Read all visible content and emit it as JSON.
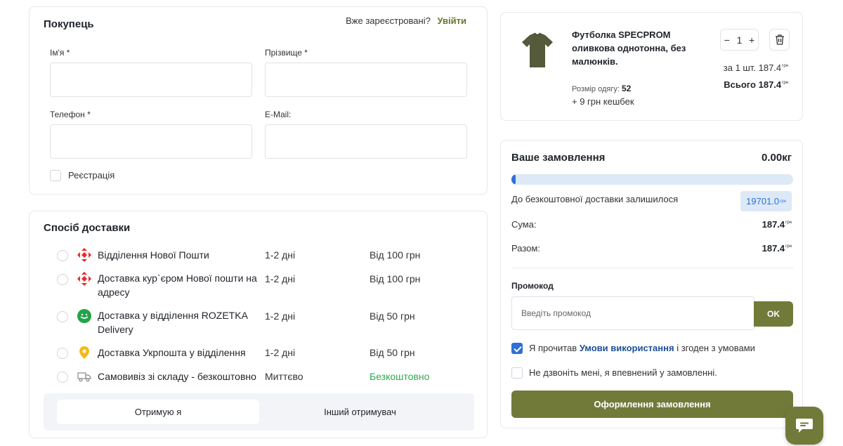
{
  "buyer": {
    "title": "Покупець",
    "registered_text": "Вже зареєстровані?",
    "login_link": "Увійти",
    "first_name_label": "Ім'я *",
    "last_name_label": "Прізвище *",
    "phone_label": "Телефон *",
    "email_label": "E-Mail:",
    "register_label": "Реєстрація"
  },
  "delivery": {
    "title": "Спосіб доставки",
    "options": [
      {
        "name": "Відділення Нової Пошти",
        "time": "1-2 дні",
        "price": "Від 100 грн",
        "icon": "nova-poshta-icon"
      },
      {
        "name": "Доставка кур`єром Нової пошти на адресу",
        "time": "1-2 дні",
        "price": "Від 100 грн",
        "icon": "nova-poshta-icon"
      },
      {
        "name": "Доставка у відділення ROZETKA Delivery",
        "time": "1-2 дні",
        "price": "Від 50 грн",
        "icon": "rozetka-icon"
      },
      {
        "name": "Доставка Укрпошта у відділення",
        "time": "1-2 дні",
        "price": "Від 50 грн",
        "icon": "ukrposhta-icon"
      },
      {
        "name": "Самовивіз зі складу - безкоштовно",
        "time": "Миттєво",
        "price": "Безкоштовно",
        "icon": "truck-icon"
      }
    ],
    "recipient_self": "Отримую я",
    "recipient_other": "Інший отримувач"
  },
  "product": {
    "name": "Футболка SPECPROM оливкова однотонна, без малюнків.",
    "size_label": "Розмір одягу:",
    "size_value": "52",
    "cashback": "+ 9 грн кешбек",
    "quantity": "1",
    "minus": "−",
    "plus": "+",
    "per_unit_label": "за 1 шт.",
    "per_unit_price": "187.4",
    "total_label": "Всього",
    "total_price": "187.4",
    "currency": "грн"
  },
  "order": {
    "title": "Ваше замовлення",
    "weight": "0.00кг",
    "free_delivery_progress": 0.01,
    "free_delivery_text": "До безкоштовної доставки залишилося",
    "free_delivery_remaining": "19701.0",
    "sum_label": "Сума:",
    "sum_value": "187.4",
    "total_label": "Разом:",
    "total_value": "187.4",
    "currency": "грн",
    "promo_label": "Промокод",
    "promo_placeholder": "Введіть промокод",
    "promo_button": "OK",
    "terms_prefix": "Я прочитав",
    "terms_link": "Умови використання",
    "terms_suffix": "і згоден з умовами",
    "no_call_text": "Не дзвоніть мені, я впевнений у замовленні.",
    "checkout_button": "Оформлення замовлення"
  },
  "colors": {
    "accent": "#727a3a",
    "link": "#1d4f9c",
    "progress": "#2f6fd6",
    "free": "#2eaa4f",
    "nova_poshta": "#e52b2b",
    "rozetka": "#22a447",
    "ukrposhta": "#f6b817"
  }
}
